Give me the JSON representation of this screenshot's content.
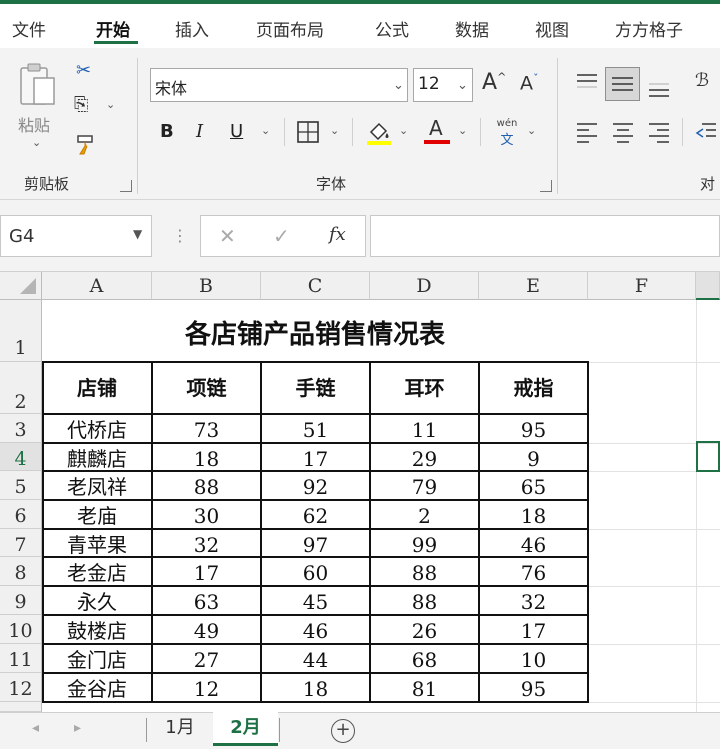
{
  "menu": {
    "tabs": [
      "文件",
      "开始",
      "插入",
      "页面布局",
      "公式",
      "数据",
      "视图",
      "方方格子"
    ],
    "active_index": 1
  },
  "ribbon": {
    "clipboard": {
      "paste_label": "粘贴",
      "group_label": "剪贴板"
    },
    "font": {
      "family": "宋体",
      "size": "12",
      "group_label": "字体",
      "bold": "B",
      "italic": "I",
      "underline": "U",
      "font_color_glyph": "A",
      "phonetic_top": "wén",
      "phonetic_bottom": "文"
    },
    "align": {
      "group_label_partial": "对"
    },
    "colors": {
      "accent": "#1e7145",
      "highlight_yellow": "#ffff00",
      "font_red": "#e00000"
    }
  },
  "formula_bar": {
    "name_box": "G4",
    "fx_label": "fx",
    "value": ""
  },
  "sheet": {
    "columns": [
      "A",
      "B",
      "C",
      "D",
      "E",
      "F"
    ],
    "rows": [
      "1",
      "2",
      "3",
      "4",
      "5",
      "6",
      "7",
      "8",
      "9",
      "10",
      "11",
      "12"
    ],
    "selected_row": "4",
    "selected_cell": "G4",
    "title": "各店铺产品销售情况表",
    "headers": [
      "店铺",
      "项链",
      "手链",
      "耳环",
      "戒指"
    ],
    "data": [
      [
        "代桥店",
        "73",
        "51",
        "11",
        "95"
      ],
      [
        "麒麟店",
        "18",
        "17",
        "29",
        "9"
      ],
      [
        "老凤祥",
        "88",
        "92",
        "79",
        "65"
      ],
      [
        "老庙",
        "30",
        "62",
        "2",
        "18"
      ],
      [
        "青苹果",
        "32",
        "97",
        "99",
        "46"
      ],
      [
        "老金店",
        "17",
        "60",
        "88",
        "76"
      ],
      [
        "永久",
        "63",
        "45",
        "88",
        "32"
      ],
      [
        "鼓楼店",
        "49",
        "46",
        "26",
        "17"
      ],
      [
        "金门店",
        "27",
        "44",
        "68",
        "10"
      ],
      [
        "金谷店",
        "12",
        "18",
        "81",
        "95"
      ]
    ]
  },
  "sheet_tabs": {
    "tabs": [
      "1月",
      "2月"
    ],
    "active_index": 1
  }
}
